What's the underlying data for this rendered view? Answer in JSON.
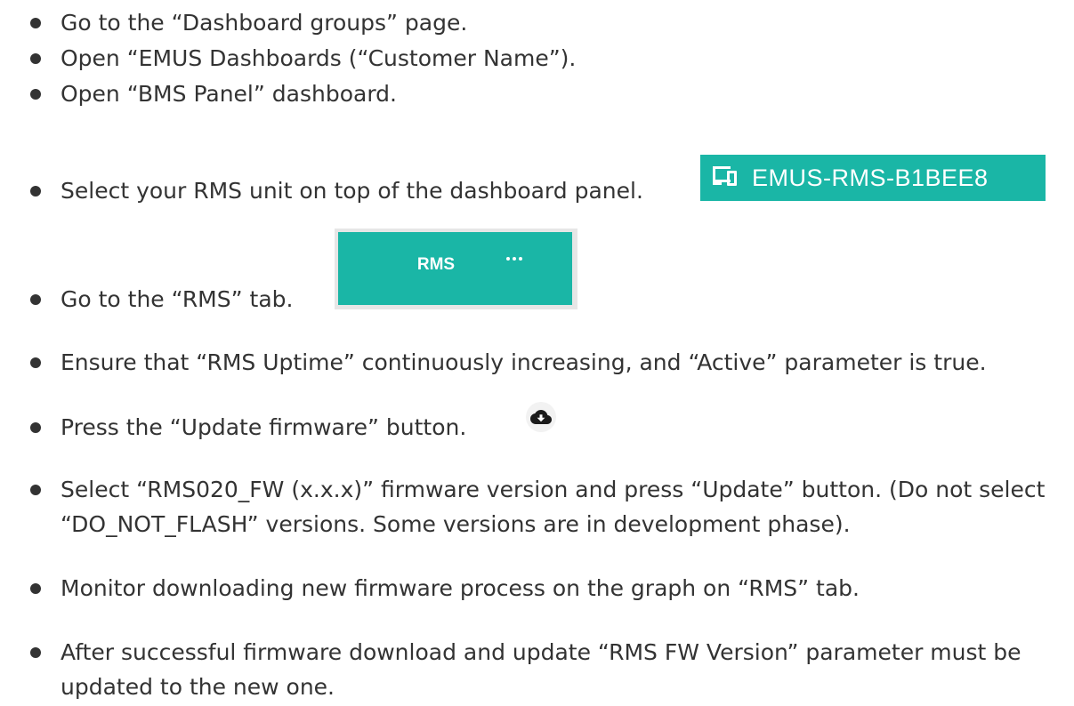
{
  "instructions": [
    {
      "text": "Go to the “Dashboard groups” page."
    },
    {
      "text": "Open “EMUS Dashboards (“Customer Name”)."
    },
    {
      "text": "Open “BMS Panel” dashboard."
    },
    {
      "text": "Select your RMS unit on top of the dashboard panel."
    },
    {
      "text": "Go to the “RMS” tab."
    },
    {
      "text": "Ensure that “RMS Uptime” continuously increasing, and “Active” parameter is true."
    },
    {
      "text": "Press the “Update firmware” button."
    },
    {
      "text": "Select “RMS020_FW (x.x.x)” firmware version and press “Update” button. (Do not select “DO_NOT_FLASH” versions. Some versions are in development phase)."
    },
    {
      "text": "Monitor downloading new firmware process on the graph on “RMS” tab."
    },
    {
      "text": "After successful firmware download and update “RMS FW Version” parameter must be updated to the new one."
    }
  ],
  "device_chip": {
    "icon": "devices-icon",
    "name": "EMUS-RMS-B1BEE8",
    "color": "#1ab6a6"
  },
  "rms_tab": {
    "label": "RMS",
    "menu_icon": "more-horizontal-icon",
    "color": "#1ab6a6"
  },
  "update_button": {
    "icon": "cloud-download-icon"
  }
}
